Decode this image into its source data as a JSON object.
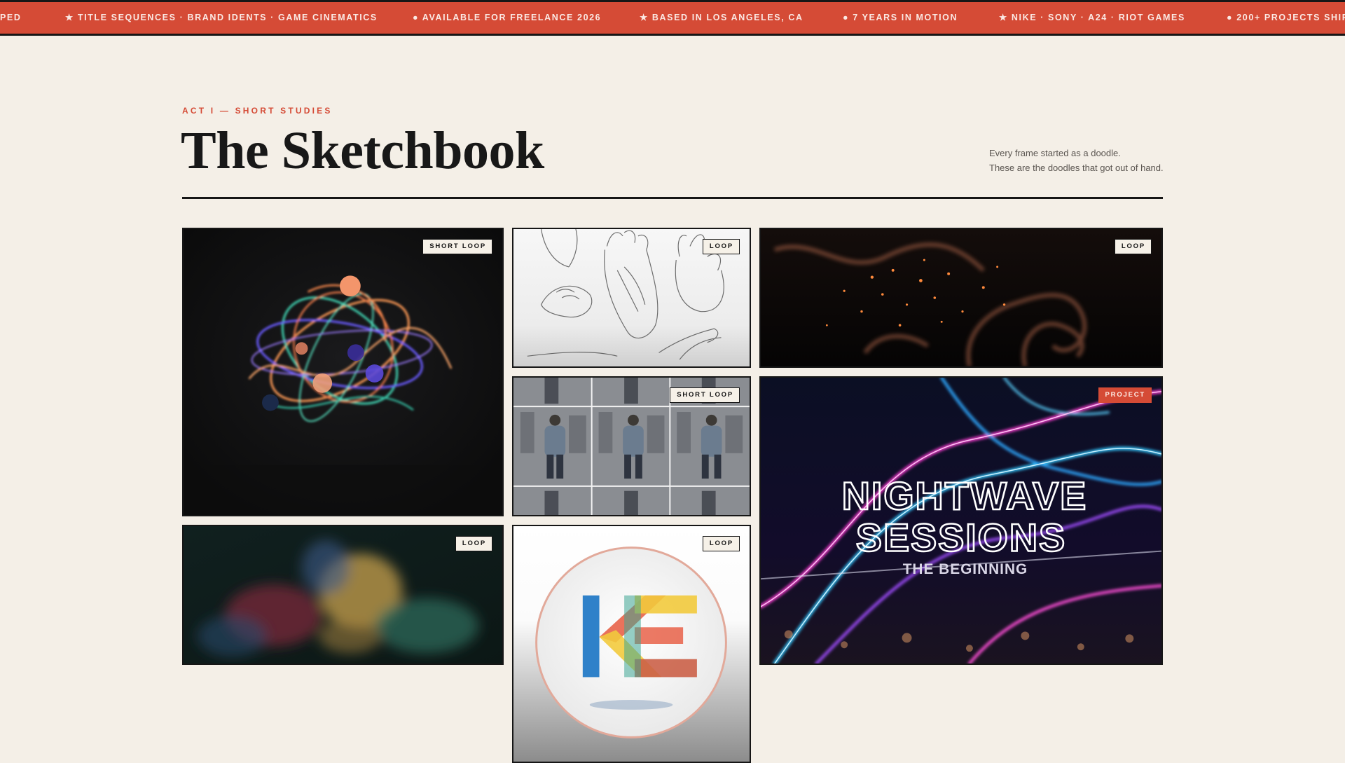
{
  "marquee": {
    "items": [
      "PED",
      "★ TITLE SEQUENCES · BRAND IDENTS · GAME CINEMATICS",
      "● AVAILABLE FOR FREELANCE 2026",
      "★ BASED IN LOS ANGELES, CA",
      "● 7 YEARS IN MOTION",
      "★ NIKE · SONY · A24 · RIOT GAMES",
      "● 200+ PROJECTS SHIP"
    ]
  },
  "header": {
    "eyebrow": "ACT I — SHORT STUDIES",
    "title": "The Sketchbook",
    "blurb_line1": "Every frame started as a doodle.",
    "blurb_line2": "These are the doodles that got out of hand."
  },
  "tiles": [
    {
      "tag": "SHORT LOOP"
    },
    {
      "tag": "LOOP"
    },
    {
      "tag": "LOOP"
    },
    {
      "tag": "SHORT LOOP"
    },
    {
      "tag": "PROJECT",
      "title_line1": "NIGHTWAVE",
      "title_line2": "SESSIONS",
      "subtitle": "THE BEGINNING"
    },
    {
      "tag": "LOOP"
    },
    {
      "tag": "LOOP",
      "logo_text": "KE"
    }
  ],
  "colors": {
    "accent": "#d54b36",
    "background": "#f4efe7",
    "ink": "#161616"
  }
}
